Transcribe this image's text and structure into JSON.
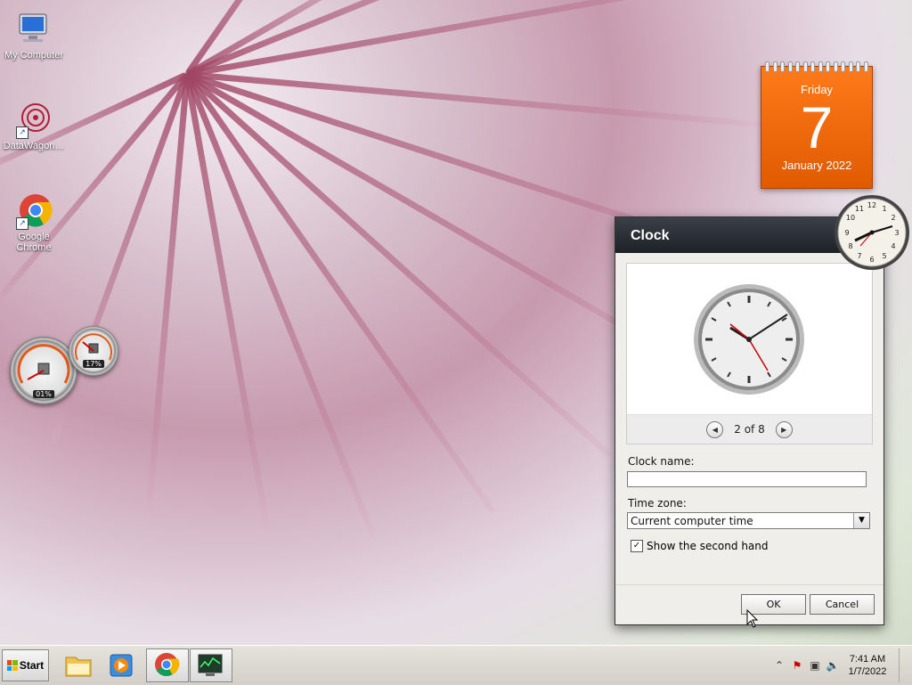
{
  "desktop": {
    "icons": [
      {
        "label": "My Computer"
      },
      {
        "label": "DataWagon…"
      },
      {
        "label": "Google Chrome"
      }
    ],
    "gauges": {
      "cpu": "01%",
      "memory": "17%"
    }
  },
  "calendar": {
    "day": "Friday",
    "date": "7",
    "month_year": "January 2022"
  },
  "dialog": {
    "title": "Clock",
    "pager": "2 of 8",
    "clock_name_label": "Clock name:",
    "clock_name_value": "",
    "timezone_label": "Time zone:",
    "timezone_value": "Current computer time",
    "second_hand_label": "Show the second hand",
    "second_hand_checked": true,
    "ok_label": "OK",
    "cancel_label": "Cancel"
  },
  "taskbar": {
    "start_label": "Start",
    "time": "7:41 AM",
    "date": "1/7/2022"
  },
  "colors": {
    "calendar_orange": "#f06a10",
    "titlebar": "#1e2227"
  },
  "icons": {
    "start": "windows-flag-icon",
    "explorer": "folder-icon",
    "media": "media-player-icon",
    "chrome": "chrome-icon",
    "monitor": "resource-monitor-icon"
  }
}
